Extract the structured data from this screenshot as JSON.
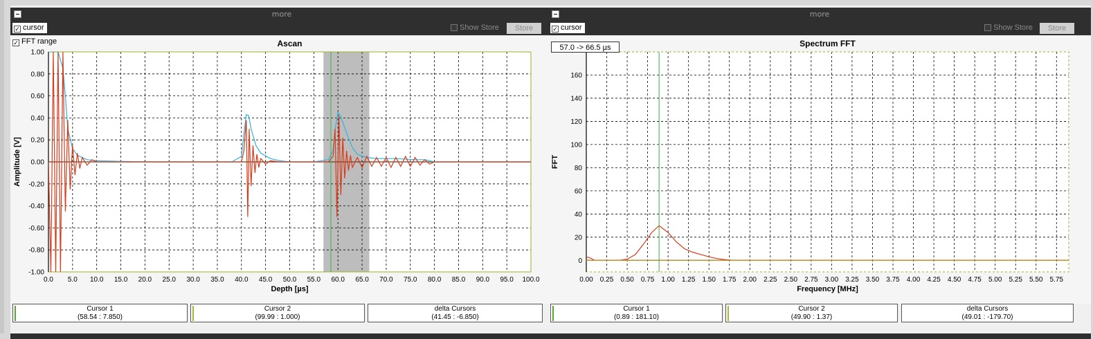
{
  "panels": [
    {
      "title_bar": "more",
      "cursor_label": "cursor",
      "cursor_checked": true,
      "show_store_label": "Show Store",
      "store_label": "Store",
      "fft_range_label": "FFT range",
      "cursors": [
        {
          "title": "Cursor 1",
          "value": "(58.54 : 7.850)",
          "color": "#5aa832"
        },
        {
          "title": "Cursor 2",
          "value": "(99.99 : 1.000)",
          "color": "#a8b832"
        },
        {
          "title": "delta Cursors",
          "value": "(41.45 : -6.850)",
          "color": ""
        }
      ]
    },
    {
      "title_bar": "more",
      "cursor_label": "cursor",
      "cursor_checked": true,
      "show_store_label": "Show Store",
      "store_label": "Store",
      "range_label": "57.0 -> 66.5 µs",
      "cursors": [
        {
          "title": "Cursor 1",
          "value": "(0.89 : 181.10)",
          "color": "#5aa832"
        },
        {
          "title": "Cursor 2",
          "value": "(49.90 : 1.37)",
          "color": "#a8b832"
        },
        {
          "title": "delta Cursors",
          "value": "(49.01 : -179.70)",
          "color": ""
        }
      ]
    }
  ],
  "chart_data": [
    {
      "type": "line",
      "title": "Ascan",
      "xlabel": "Depth [µs]",
      "ylabel": "Amplitude [V]",
      "xlim": [
        0,
        100
      ],
      "ylim": [
        -1,
        1
      ],
      "xticks": [
        "0.0",
        "5.0",
        "10.0",
        "15.0",
        "20.0",
        "25.0",
        "30.0",
        "35.0",
        "40.0",
        "45.0",
        "50.0",
        "55.0",
        "60.0",
        "65.0",
        "70.0",
        "75.0",
        "80.0",
        "85.0",
        "90.0",
        "95.0",
        "100.0"
      ],
      "yticks": [
        "-1.00",
        "-0.80",
        "-0.60",
        "-0.40",
        "-0.20",
        "0.00",
        "0.20",
        "0.40",
        "0.60",
        "0.80",
        "1.00"
      ],
      "grid": true,
      "fft_range": [
        57.0,
        66.5
      ],
      "cursor_x": 58.54,
      "series": [
        {
          "color": "#2cb5e0",
          "x": [
            0,
            2,
            3,
            3.5,
            4,
            5,
            6,
            8,
            10,
            15,
            20,
            30,
            38,
            40,
            40.5,
            41,
            41.5,
            42,
            43,
            44,
            46,
            48,
            50,
            55,
            58,
            59,
            59.5,
            60,
            60.5,
            61,
            62,
            63,
            64,
            66,
            68,
            72,
            76,
            78,
            80,
            85,
            90,
            100
          ],
          "values": [
            1,
            1,
            0.85,
            0.6,
            0.3,
            0.12,
            0.06,
            0.02,
            0.01,
            0.005,
            0.0,
            0.0,
            0.0,
            0.05,
            0.25,
            0.43,
            0.42,
            0.3,
            0.15,
            0.08,
            0.03,
            0.01,
            0.0,
            0.0,
            0.02,
            0.1,
            0.32,
            0.45,
            0.42,
            0.36,
            0.24,
            0.13,
            0.07,
            0.04,
            0.03,
            0.03,
            0.02,
            0.02,
            0.0,
            0.0,
            0.0,
            0.0
          ]
        },
        {
          "color": "#d83a1a",
          "x": [
            0,
            0.5,
            1,
            1.5,
            2,
            2.5,
            3,
            3.5,
            4,
            4.5,
            5,
            5.5,
            6,
            6.5,
            7,
            8,
            9,
            10,
            15,
            20,
            30,
            38,
            40,
            40.5,
            41,
            41.3,
            41.6,
            42,
            42.4,
            42.8,
            43.2,
            43.6,
            44,
            45,
            46,
            48,
            50,
            55,
            58,
            59,
            59.4,
            59.8,
            60.2,
            60.6,
            61,
            61.4,
            61.8,
            62.2,
            62.6,
            63,
            64,
            65,
            66,
            67,
            68,
            69,
            70,
            71,
            72,
            73,
            74,
            75,
            76,
            77,
            78,
            79,
            80,
            85,
            90,
            100
          ],
          "values": [
            0,
            -1,
            1,
            -1,
            1,
            -1,
            1,
            -0.45,
            0.38,
            -0.25,
            0.15,
            -0.12,
            0.08,
            -0.06,
            0.04,
            -0.03,
            0.02,
            0,
            0,
            0,
            0,
            0,
            0,
            0.1,
            0.38,
            -0.5,
            0.3,
            -0.22,
            0.15,
            -0.1,
            0.07,
            -0.05,
            0.03,
            -0.02,
            0.01,
            0,
            0,
            0,
            0,
            0.05,
            0.3,
            -0.5,
            0.42,
            -0.3,
            0.22,
            -0.15,
            0.1,
            -0.08,
            0.06,
            -0.05,
            0.04,
            -0.05,
            0.05,
            -0.04,
            0.04,
            -0.04,
            0.04,
            -0.05,
            0.04,
            -0.04,
            0.05,
            -0.04,
            0.04,
            -0.03,
            0.02,
            -0.02,
            0,
            0,
            0,
            0
          ]
        }
      ]
    },
    {
      "type": "line",
      "title": "Spectrum FFT",
      "xlabel": "Frequency [MHz]",
      "ylabel": "FFT",
      "xlim": [
        0,
        5.9
      ],
      "ylim": [
        -10,
        180
      ],
      "xticks": [
        "0.00",
        "0.25",
        "0.50",
        "0.75",
        "1.00",
        "1.25",
        "1.50",
        "1.75",
        "2.00",
        "2.25",
        "2.50",
        "2.75",
        "3.00",
        "3.25",
        "3.50",
        "3.75",
        "4.00",
        "4.25",
        "4.50",
        "4.75",
        "5.00",
        "5.25",
        "5.50",
        "5.75"
      ],
      "yticks": [
        "0",
        "20",
        "40",
        "60",
        "80",
        "100",
        "120",
        "140",
        "160"
      ],
      "grid": true,
      "cursor_x": 0.89,
      "series": [
        {
          "color": "#d83a1a",
          "x": [
            0,
            0.05,
            0.1,
            0.2,
            0.3,
            0.4,
            0.5,
            0.6,
            0.7,
            0.8,
            0.89,
            1.0,
            1.1,
            1.2,
            1.3,
            1.4,
            1.5,
            1.6,
            1.7,
            1.8,
            1.9,
            2.0,
            2.5,
            3.0,
            3.5,
            4.0,
            4.5,
            5.0,
            5.5,
            5.9
          ],
          "values": [
            3,
            2,
            0,
            0,
            0,
            0,
            1,
            5,
            14,
            24,
            30,
            24,
            16,
            10,
            7,
            5,
            3,
            1.5,
            0.5,
            0,
            0,
            0,
            0,
            0,
            0,
            0,
            0,
            0,
            0,
            0
          ]
        },
        {
          "color": "#c8a028",
          "x": [
            0,
            5.9
          ],
          "values": [
            0,
            0
          ]
        }
      ]
    }
  ]
}
